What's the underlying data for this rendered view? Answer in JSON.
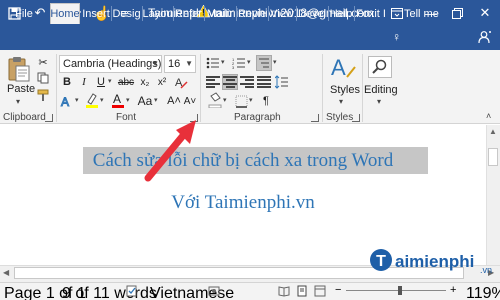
{
  "titlebar": {
    "doc_title": "Taimienphi.vn...",
    "warning_email": "taimienphivn2018@gmail.com"
  },
  "tabs": [
    {
      "label": "File"
    },
    {
      "label": "Home"
    },
    {
      "label": "Insert"
    },
    {
      "label": "Desig"
    },
    {
      "label": "Layou"
    },
    {
      "label": "Refer"
    },
    {
      "label": "Mailir"
    },
    {
      "label": "Revie"
    },
    {
      "label": "View"
    },
    {
      "label": "Devel"
    },
    {
      "label": "Help"
    },
    {
      "label": "Foxit I"
    }
  ],
  "tell_me": "Tell me",
  "ribbon": {
    "paste_label": "Paste",
    "font_name": "Cambria (Headings)",
    "font_size": "16",
    "styles_label": "Styles",
    "editing_label": "Editing",
    "groups": {
      "clipboard": "Clipboard",
      "font": "Font",
      "paragraph": "Paragraph",
      "styles": "Styles"
    }
  },
  "document": {
    "line1": "Cách sửa lỗi chữ bị cách xa trong Word",
    "line2": "Với Taimienphi.vn"
  },
  "status": {
    "page": "Page 1 of 1",
    "words": "9 of 11 words",
    "language": "Vietnamese",
    "zoom_minus": "−",
    "zoom_plus": "+",
    "zoom": "119%"
  },
  "watermark": {
    "brand_prefix": "T",
    "brand": "aimienphi",
    "tld": ".vn"
  }
}
